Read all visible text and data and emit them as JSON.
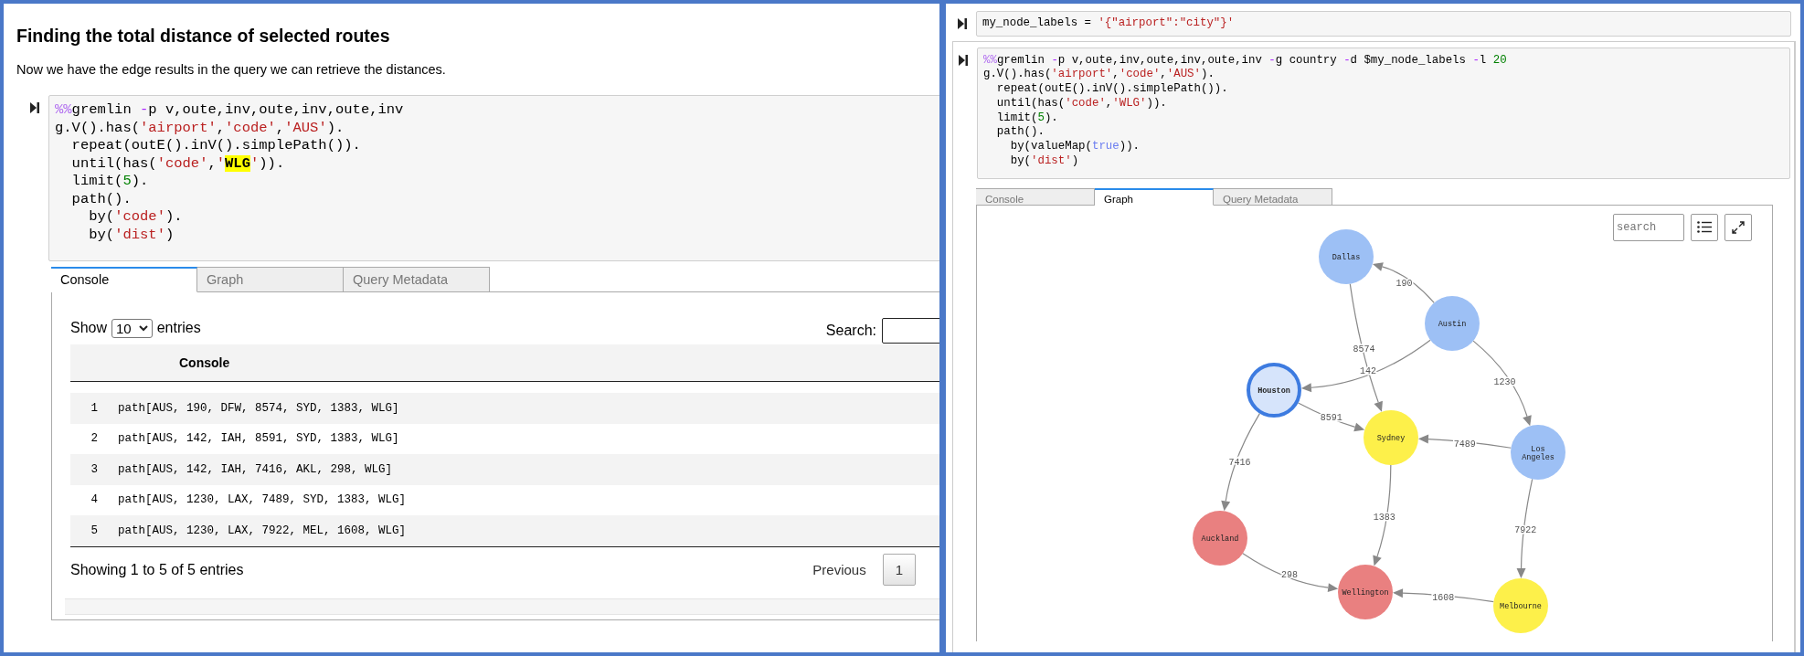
{
  "left": {
    "heading": "Finding the total distance of selected routes",
    "paragraph": "Now we have the edge results in the query we can retrieve the distances.",
    "code_cell": {
      "lines": [
        [
          {
            "kind": "magic",
            "text": "%%"
          },
          {
            "kind": "plain",
            "text": "gremlin "
          },
          {
            "kind": "op",
            "text": "-"
          },
          {
            "kind": "plain",
            "text": "p v,oute,inv,oute,inv,oute,inv"
          }
        ],
        [
          {
            "kind": "plain",
            "text": "g.V().has("
          },
          {
            "kind": "string",
            "text": "'airport'"
          },
          {
            "kind": "plain",
            "text": ","
          },
          {
            "kind": "string",
            "text": "'code'"
          },
          {
            "kind": "plain",
            "text": ","
          },
          {
            "kind": "string",
            "text": "'AUS'"
          },
          {
            "kind": "plain",
            "text": ")."
          }
        ],
        [
          {
            "kind": "plain",
            "text": "  repeat(outE().inV().simplePath())."
          }
        ],
        [
          {
            "kind": "plain",
            "text": "  until(has("
          },
          {
            "kind": "string",
            "text": "'code'"
          },
          {
            "kind": "plain",
            "text": ","
          },
          {
            "kind": "string",
            "text": "'"
          },
          {
            "kind": "match",
            "text": "WLG"
          },
          {
            "kind": "string",
            "text": "'"
          },
          {
            "kind": "plain",
            "text": "))."
          }
        ],
        [
          {
            "kind": "plain",
            "text": "  limit("
          },
          {
            "kind": "number",
            "text": "5"
          },
          {
            "kind": "plain",
            "text": ")."
          }
        ],
        [
          {
            "kind": "plain",
            "text": "  path()."
          }
        ],
        [
          {
            "kind": "plain",
            "text": "    by("
          },
          {
            "kind": "string",
            "text": "'code'"
          },
          {
            "kind": "plain",
            "text": ")."
          }
        ],
        [
          {
            "kind": "plain",
            "text": "    by("
          },
          {
            "kind": "string",
            "text": "'dist'"
          },
          {
            "kind": "plain",
            "text": ")"
          }
        ]
      ]
    },
    "tabs": [
      {
        "label": "Console",
        "selected": true
      },
      {
        "label": "Graph",
        "selected": false
      },
      {
        "label": "Query Metadata",
        "selected": false
      }
    ],
    "table": {
      "show_label": "Show",
      "page_size": "10",
      "entries_label": "entries",
      "search_label": "Search:",
      "columns": [
        "Console"
      ],
      "rows": [
        {
          "index": "1",
          "path": "path[AUS, 190, DFW, 8574, SYD, 1383, WLG]"
        },
        {
          "index": "2",
          "path": "path[AUS, 142, IAH, 8591, SYD, 1383, WLG]"
        },
        {
          "index": "3",
          "path": "path[AUS, 142, IAH, 7416, AKL, 298, WLG]"
        },
        {
          "index": "4",
          "path": "path[AUS, 1230, LAX, 7489, SYD, 1383, WLG]"
        },
        {
          "index": "5",
          "path": "path[AUS, 1230, LAX, 7922, MEL, 1608, WLG]"
        }
      ],
      "info": "Showing 1 to 5 of 5 entries",
      "pager": [
        {
          "label": "Previous",
          "selected": false
        },
        {
          "label": "1",
          "selected": true
        }
      ]
    }
  },
  "right": {
    "cells": [
      {
        "lines": [
          [
            {
              "kind": "plain",
              "text": "my_node_labels = "
            },
            {
              "kind": "string",
              "text": "'{\"airport\":\"city\"}'"
            }
          ]
        ]
      },
      {
        "lines": [
          [
            {
              "kind": "magic",
              "text": "%%"
            },
            {
              "kind": "plain",
              "text": "gremlin "
            },
            {
              "kind": "op",
              "text": "-"
            },
            {
              "kind": "plain",
              "text": "p v,oute,inv,oute,inv,oute,inv "
            },
            {
              "kind": "op",
              "text": "-"
            },
            {
              "kind": "plain",
              "text": "g country "
            },
            {
              "kind": "op",
              "text": "-"
            },
            {
              "kind": "plain",
              "text": "d $my_node_labels "
            },
            {
              "kind": "op",
              "text": "-"
            },
            {
              "kind": "plain",
              "text": "l "
            },
            {
              "kind": "number",
              "text": "20"
            }
          ],
          [
            {
              "kind": "plain",
              "text": "g.V().has("
            },
            {
              "kind": "string",
              "text": "'airport'"
            },
            {
              "kind": "plain",
              "text": ","
            },
            {
              "kind": "string",
              "text": "'code'"
            },
            {
              "kind": "plain",
              "text": ","
            },
            {
              "kind": "string",
              "text": "'AUS'"
            },
            {
              "kind": "plain",
              "text": ")."
            }
          ],
          [
            {
              "kind": "plain",
              "text": "  repeat(outE().inV().simplePath())."
            }
          ],
          [
            {
              "kind": "plain",
              "text": "  until(has("
            },
            {
              "kind": "string",
              "text": "'code'"
            },
            {
              "kind": "plain",
              "text": ","
            },
            {
              "kind": "string",
              "text": "'WLG'"
            },
            {
              "kind": "plain",
              "text": "))."
            }
          ],
          [
            {
              "kind": "plain",
              "text": "  limit("
            },
            {
              "kind": "number",
              "text": "5"
            },
            {
              "kind": "plain",
              "text": ")."
            }
          ],
          [
            {
              "kind": "plain",
              "text": "  path()."
            }
          ],
          [
            {
              "kind": "plain",
              "text": "    by(valueMap("
            },
            {
              "kind": "keyword",
              "text": "true"
            },
            {
              "kind": "plain",
              "text": "))."
            }
          ],
          [
            {
              "kind": "plain",
              "text": "    by("
            },
            {
              "kind": "string",
              "text": "'dist'"
            },
            {
              "kind": "plain",
              "text": ")"
            }
          ]
        ]
      }
    ],
    "tabs": [
      {
        "label": "Console",
        "selected": false
      },
      {
        "label": "Graph",
        "selected": true
      },
      {
        "label": "Query Metadata",
        "selected": false
      }
    ],
    "graph": {
      "search_placeholder": "search",
      "nodes": [
        {
          "label": "Dallas",
          "color": "#9dc0f5",
          "selected": false
        },
        {
          "label": "Austin",
          "color": "#9dc0f5",
          "selected": false
        },
        {
          "label": "Houston",
          "color": "#d6e4fb",
          "selected": true
        },
        {
          "label": "Sydney",
          "color": "#fdf04a",
          "selected": false
        },
        {
          "label": "Los Angeles",
          "color": "#9dc0f5",
          "selected": false
        },
        {
          "label": "Auckland",
          "color": "#e98080",
          "selected": false
        },
        {
          "label": "Wellington",
          "color": "#e98080",
          "selected": false
        },
        {
          "label": "Melbourne",
          "color": "#fdf04a",
          "selected": false
        }
      ],
      "edges": [
        {
          "label": "190"
        },
        {
          "label": "8574"
        },
        {
          "label": "142"
        },
        {
          "label": "1230"
        },
        {
          "label": "8591"
        },
        {
          "label": "7489"
        },
        {
          "label": "7416"
        },
        {
          "label": "1383"
        },
        {
          "label": "7922"
        },
        {
          "label": "298"
        },
        {
          "label": "1608"
        }
      ]
    }
  }
}
